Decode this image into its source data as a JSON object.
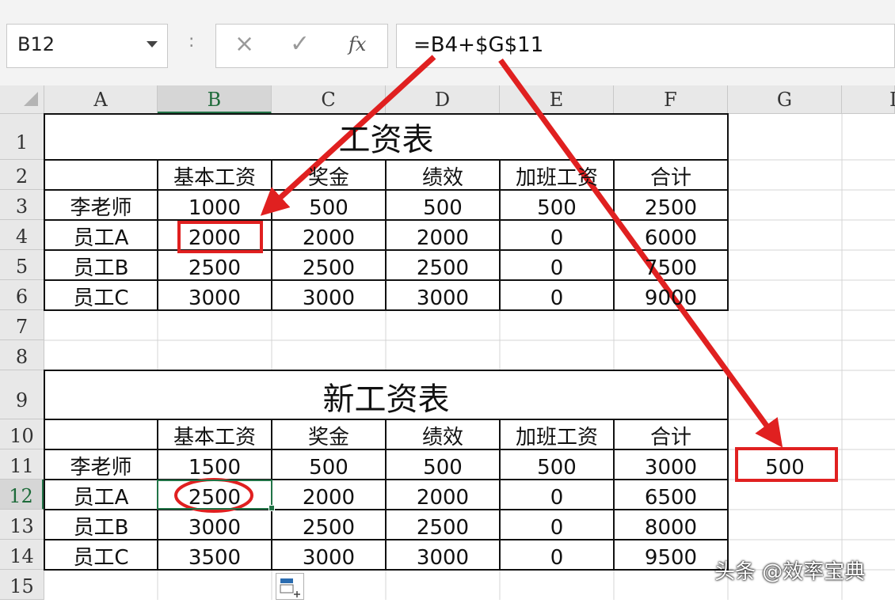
{
  "formula_bar": {
    "name_box": "B12",
    "separator": ":",
    "cancel_icon": "×",
    "enter_icon": "✓",
    "fx_label": "fx",
    "formula": "=B4+$G$11"
  },
  "columns": [
    "A",
    "B",
    "C",
    "D",
    "E",
    "F",
    "G",
    "I"
  ],
  "rows": [
    "1",
    "2",
    "3",
    "4",
    "5",
    "6",
    "7",
    "8",
    "9",
    "10",
    "11",
    "12",
    "13",
    "14",
    "15"
  ],
  "table1": {
    "title": "工资表",
    "headers": [
      "基本工资",
      "奖金",
      "绩效",
      "加班工资",
      "合计"
    ],
    "rows": [
      {
        "name": "李老师",
        "values": [
          "1000",
          "500",
          "500",
          "500",
          "2500"
        ]
      },
      {
        "name": "员工A",
        "values": [
          "2000",
          "2000",
          "2000",
          "0",
          "6000"
        ]
      },
      {
        "name": "员工B",
        "values": [
          "2500",
          "2500",
          "2500",
          "0",
          "7500"
        ]
      },
      {
        "name": "员工C",
        "values": [
          "3000",
          "3000",
          "3000",
          "0",
          "9000"
        ]
      }
    ]
  },
  "table2": {
    "title": "新工资表",
    "headers": [
      "基本工资",
      "奖金",
      "绩效",
      "加班工资",
      "合计"
    ],
    "rows": [
      {
        "name": "李老师",
        "values": [
          "1500",
          "500",
          "500",
          "500",
          "3000"
        ]
      },
      {
        "name": "员工A",
        "values": [
          "2500",
          "2000",
          "2000",
          "0",
          "6500"
        ]
      },
      {
        "name": "员工B",
        "values": [
          "3000",
          "2500",
          "2500",
          "0",
          "8000"
        ]
      },
      {
        "name": "员工C",
        "values": [
          "3500",
          "3000",
          "3000",
          "0",
          "9500"
        ]
      }
    ]
  },
  "g11_value": "500",
  "watermark": "头条 @效率宝典",
  "colors": {
    "accent": "#217346",
    "annotation": "#e02020"
  }
}
